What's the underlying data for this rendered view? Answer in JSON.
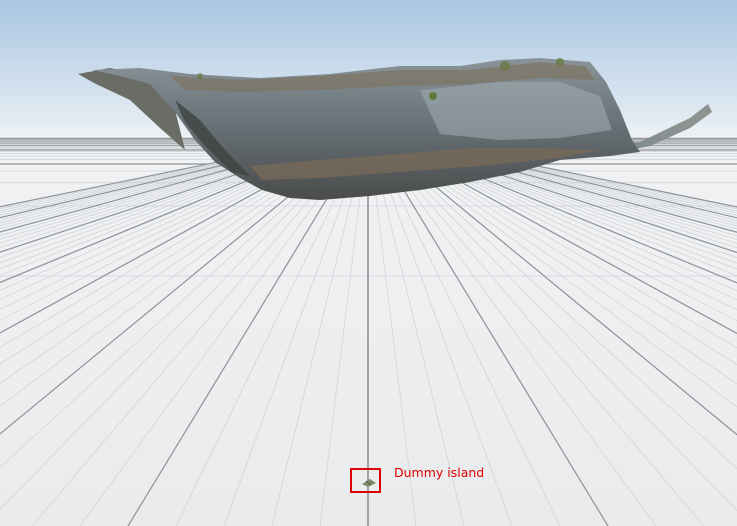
{
  "viewport": {
    "sky_top_color": "#a9c6e3",
    "horizon_color": "#eef2f6",
    "ground_color": "#eceeef",
    "grid_minor_color": "#d2d5d8",
    "grid_major_color": "#8e9296",
    "model_colors": {
      "rock_dark": "#4a4c4a",
      "rock_mid": "#6e7a80",
      "rock_light": "#9aa6aa",
      "earth": "#8a6a4e",
      "vegetation": "#5e7a3c"
    }
  },
  "annotation": {
    "label": "Dummy island",
    "color": "#e00000"
  },
  "marker": {
    "icon": "dummy-island-marker-icon"
  }
}
